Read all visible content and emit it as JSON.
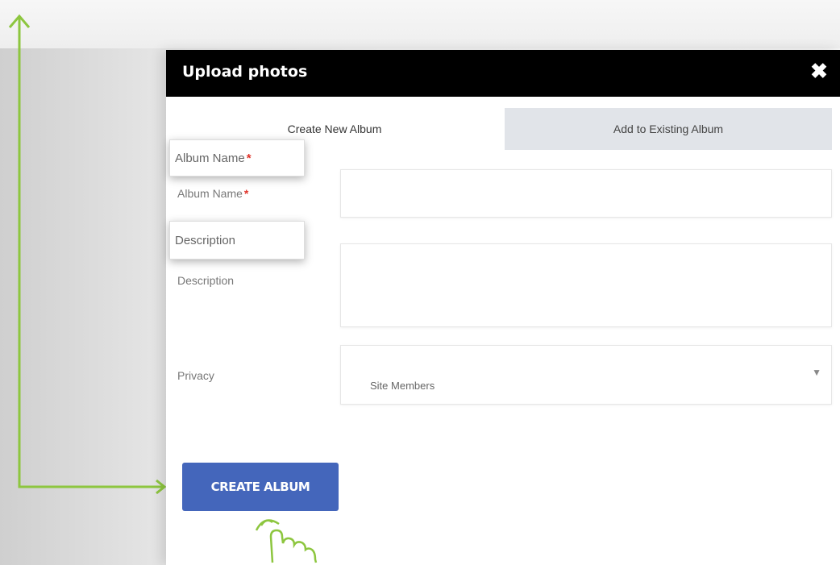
{
  "modal": {
    "title": "Upload photos",
    "close_glyph": "✖",
    "tabs": [
      {
        "label": "Create New Album",
        "active": true
      },
      {
        "label": "Add to Existing Album",
        "active": false
      }
    ],
    "fields": {
      "album_name": {
        "label": "Album Name",
        "required_mark": "*",
        "value": ""
      },
      "description": {
        "label": "Description",
        "value": ""
      },
      "privacy": {
        "label": "Privacy",
        "selected": "Site Members",
        "caret": "▼"
      }
    },
    "create_button_label": "CREATE ALBUM"
  },
  "callouts": {
    "album_name": {
      "label": "Album Name",
      "required_mark": "*"
    },
    "description": {
      "label": "Description"
    }
  },
  "colors": {
    "header_bg": "#000000",
    "button_bg": "#4466bb",
    "inactive_tab_bg": "#e1e4e9",
    "required": "#e0342b",
    "annotation": "#8dc63f"
  },
  "icons": {
    "close": "close-icon",
    "caret": "chevron-down-icon",
    "annotation_arrow": "green-arrow-icon",
    "pointer": "hand-pointer-icon"
  }
}
